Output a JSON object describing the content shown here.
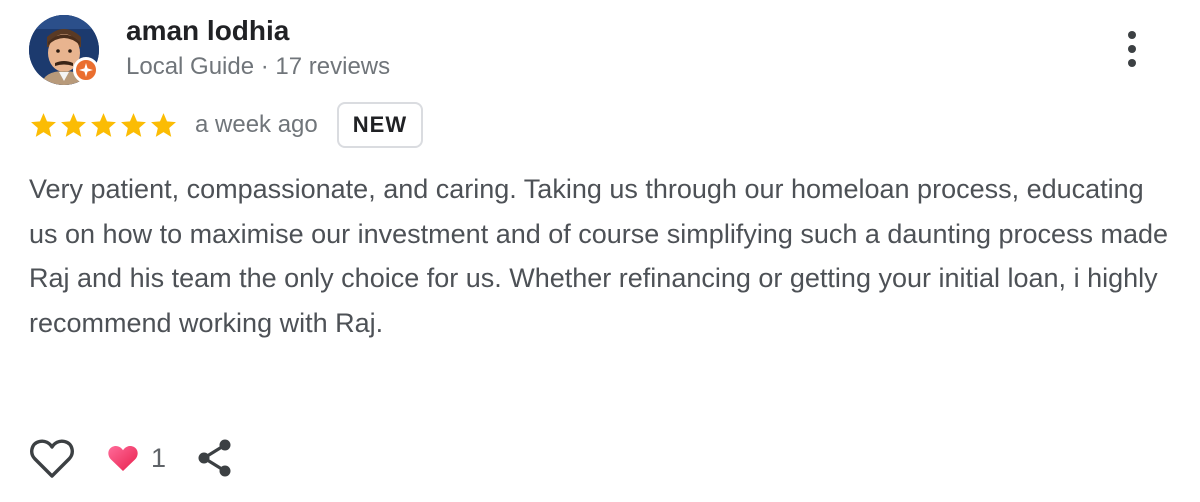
{
  "reviewer": {
    "name": "aman lodhia",
    "meta": "Local Guide · 17 reviews",
    "avatar_icon": "profile-photo",
    "badge_icon": "local-guide-badge-icon",
    "badge_color": "#ea6e2f"
  },
  "rating": {
    "stars": 5,
    "max_stars": 5,
    "star_color": "#fbbc04",
    "date": "a week ago",
    "badge": "NEW"
  },
  "review": {
    "text": "Very patient, compassionate, and caring. Taking us through our homeloan process, educating us on how to maximise our investment and of course simplifying such a daunting process made Raj and his team the only choice for us. Whether refinancing or getting your initial loan, i highly recommend working with Raj."
  },
  "actions": {
    "like_icon": "heart-outline-icon",
    "reaction_icon": "heart-reaction-icon",
    "reaction_count": "1",
    "share_icon": "share-icon",
    "more_icon": "more-vert-icon"
  }
}
